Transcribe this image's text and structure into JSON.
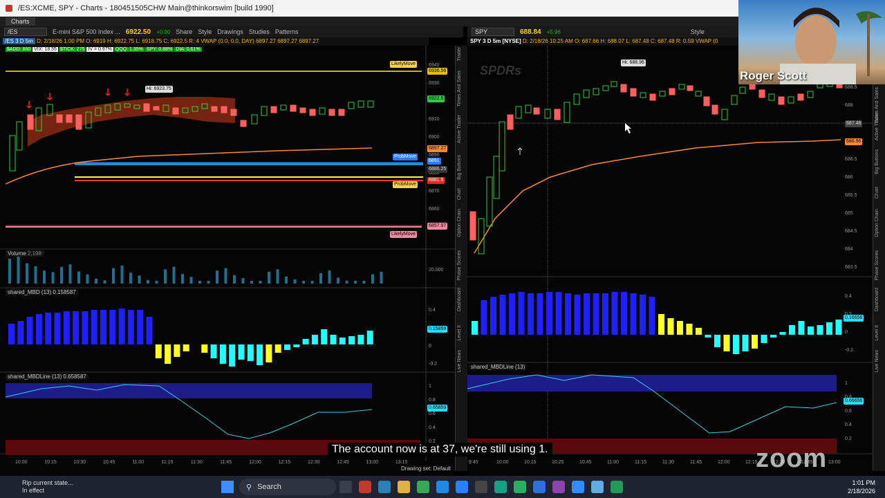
{
  "window": {
    "title": "/ES:XCME, SPY - Charts - 180451505CHW Main@thinkorswim [build 1990]",
    "tab": "Charts"
  },
  "left": {
    "symbol": "/ES",
    "desc": "E-mini S&P 500 Index ...",
    "price": "6922.50",
    "change": "+0.00",
    "buttons": [
      "Share",
      "Style",
      "Drawings",
      "Studies",
      "Patterns"
    ],
    "header": "/ES 3 D 5m",
    "info": "D: 2/18/26 1:00 PM  O: 6919  H: 6922.75  L: 6918.75  C: 6922.5  R: 4  VWAP (0.0, 0.0, DAY) 6897.27  6897.27  6897.27",
    "tags": [
      "$ADD: 860",
      "VIX: 18.55",
      "$TICK: 275",
      "IV = 0.97%",
      "QQQ: 1.35%",
      "SPY: 0.88%",
      "DIA: 0.61%"
    ],
    "hi_label": "Hi: 6923.75",
    "likely1": "LikelyMove",
    "likely2": "LikelyMove",
    "prob1": "ProbMove",
    "prob2": "ProbMove",
    "yticks": [
      "6940",
      "6930",
      "6920",
      "6910",
      "6900",
      "6890",
      "6880",
      "6870",
      "6860",
      "6850"
    ],
    "price_badges": [
      "6936.56",
      "6922.5",
      "6897.27",
      "6891",
      "6886.25",
      "6881.5",
      "6857.97"
    ],
    "volume_label": "Volume",
    "volume_val": "2,198",
    "vol_tick": "20,000",
    "mbd_label": "shared_MBD (13)",
    "mbd_val": "0.158587",
    "mbd_badge": "0.15859",
    "mbd_ticks": [
      "0.4",
      "0.2",
      "0",
      "-0.2"
    ],
    "line_label": "shared_MBDLine (13)",
    "line_val": "0.658587",
    "line_badge": "0.65859",
    "line_ticks": [
      "1",
      "0.8",
      "0.6",
      "0.4",
      "0.2"
    ],
    "xticks": [
      "10:00",
      "10:15",
      "10:30",
      "10:45",
      "11:00",
      "11:15",
      "11:30",
      "11:45",
      "12:00",
      "12:15",
      "12:30",
      "12:45",
      "13:00",
      "13:15"
    ],
    "drawing_set": "Drawing set: Default"
  },
  "right": {
    "symbol": "SPY",
    "price": "688.84",
    "change": "+5.96",
    "buttons": [
      "Style"
    ],
    "header": "SPY 3 D 5m [NYSE]",
    "info": "D: 2/18/26 10:25 AM  O: 687.66  H: 688.07  L: 687.48  C: 687.48  R: 0.59  VWAP (0",
    "hi_label": "Hi: 688.96",
    "yticks": [
      "688.5",
      "688",
      "687.5",
      "687",
      "686.5",
      "686",
      "685.5",
      "685",
      "684.5",
      "684",
      "683.5"
    ],
    "price_badges": [
      "687.48",
      "686.96"
    ],
    "mbd_badge": "0.16656",
    "mbd_ticks": [
      "0.4",
      "0.2",
      "0",
      "-0.2"
    ],
    "line_label": "shared_MBDLine (13)",
    "line_badge": "0.66656",
    "line_ticks": [
      "1",
      "0.8",
      "0.6",
      "0.4",
      "0.2"
    ],
    "xticks": [
      "9:45",
      "10:00",
      "10:15",
      "10:25",
      "10:45",
      "11:00",
      "11:15",
      "11:30",
      "11:45",
      "12:00",
      "12:15",
      "12:30",
      "12:45",
      "13:00"
    ],
    "side_tabs": [
      "Times And Sales",
      "Active Trader",
      "Big Buttons",
      "Chart",
      "Option Chain",
      "Phase Scores",
      "Dashboard",
      "Level II",
      "Live News"
    ]
  },
  "side_tabs": [
    "Trader",
    "Times And Sales",
    "Active Trader",
    "Big Buttons",
    "Chart",
    "Option Chain",
    "Phase Scores",
    "Dashboard",
    "Level II",
    "Live News"
  ],
  "webcam": {
    "name": "Roger Scott"
  },
  "caption": "The account now is at 37, we're still using 1.",
  "zoom_wm": "zoom",
  "status": {
    "line1": "Rip current state...",
    "line2": "In effect"
  },
  "taskbar": {
    "search": "Search",
    "time": "1:01 PM",
    "date": "2/18/2026"
  },
  "colors": {
    "up": "#2ecc40",
    "down": "#ff5f5f",
    "blue": "#2020ff",
    "yellow": "#ffff20",
    "cyan": "#20ffff",
    "orange": "#ff8c2a"
  }
}
